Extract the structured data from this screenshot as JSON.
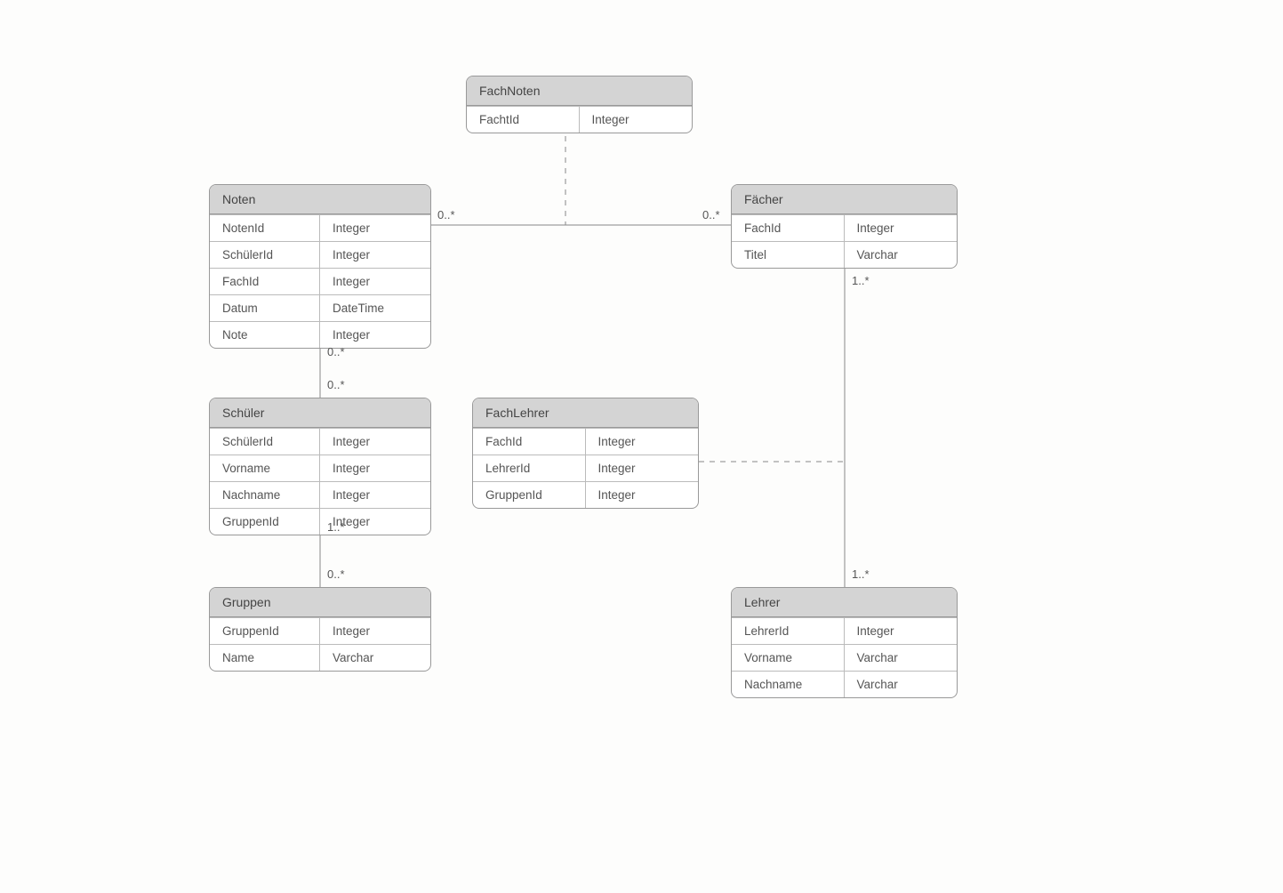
{
  "entities": {
    "fachnoten": {
      "title": "FachNoten",
      "attrs": [
        {
          "name": "FachtId",
          "type": "Integer"
        }
      ]
    },
    "noten": {
      "title": "Noten",
      "attrs": [
        {
          "name": "NotenId",
          "type": "Integer"
        },
        {
          "name": "SchülerId",
          "type": "Integer"
        },
        {
          "name": "FachId",
          "type": "Integer"
        },
        {
          "name": "Datum",
          "type": "DateTime"
        },
        {
          "name": "Note",
          "type": "Integer"
        }
      ]
    },
    "faecher": {
      "title": "Fächer",
      "attrs": [
        {
          "name": "FachId",
          "type": "Integer"
        },
        {
          "name": "Titel",
          "type": "Varchar"
        }
      ]
    },
    "schueler": {
      "title": "Schüler",
      "attrs": [
        {
          "name": "SchülerId",
          "type": "Integer"
        },
        {
          "name": "Vorname",
          "type": "Integer"
        },
        {
          "name": "Nachname",
          "type": "Integer"
        },
        {
          "name": "GruppenId",
          "type": "Integer"
        }
      ]
    },
    "fachlehrer": {
      "title": "FachLehrer",
      "attrs": [
        {
          "name": "FachId",
          "type": "Integer"
        },
        {
          "name": "LehrerId",
          "type": "Integer"
        },
        {
          "name": "GruppenId",
          "type": "Integer"
        }
      ]
    },
    "lehrer": {
      "title": "Lehrer",
      "attrs": [
        {
          "name": "LehrerId",
          "type": "Integer"
        },
        {
          "name": "Vorname",
          "type": "Varchar"
        },
        {
          "name": "Nachname",
          "type": "Varchar"
        }
      ]
    },
    "gruppen": {
      "title": "Gruppen",
      "attrs": [
        {
          "name": "GruppenId",
          "type": "Integer"
        },
        {
          "name": "Name",
          "type": "Varchar"
        }
      ]
    }
  },
  "cardinalities": {
    "noten_faecher_left": "0..*",
    "noten_faecher_right": "0..*",
    "faecher_lehrer_top": "1..*",
    "faecher_lehrer_bottom": "1..*",
    "noten_schueler_top": "0..*",
    "noten_schueler_bottom": "0..*",
    "schueler_gruppen_top": "1..*",
    "schueler_gruppen_bottom": "0..*"
  }
}
